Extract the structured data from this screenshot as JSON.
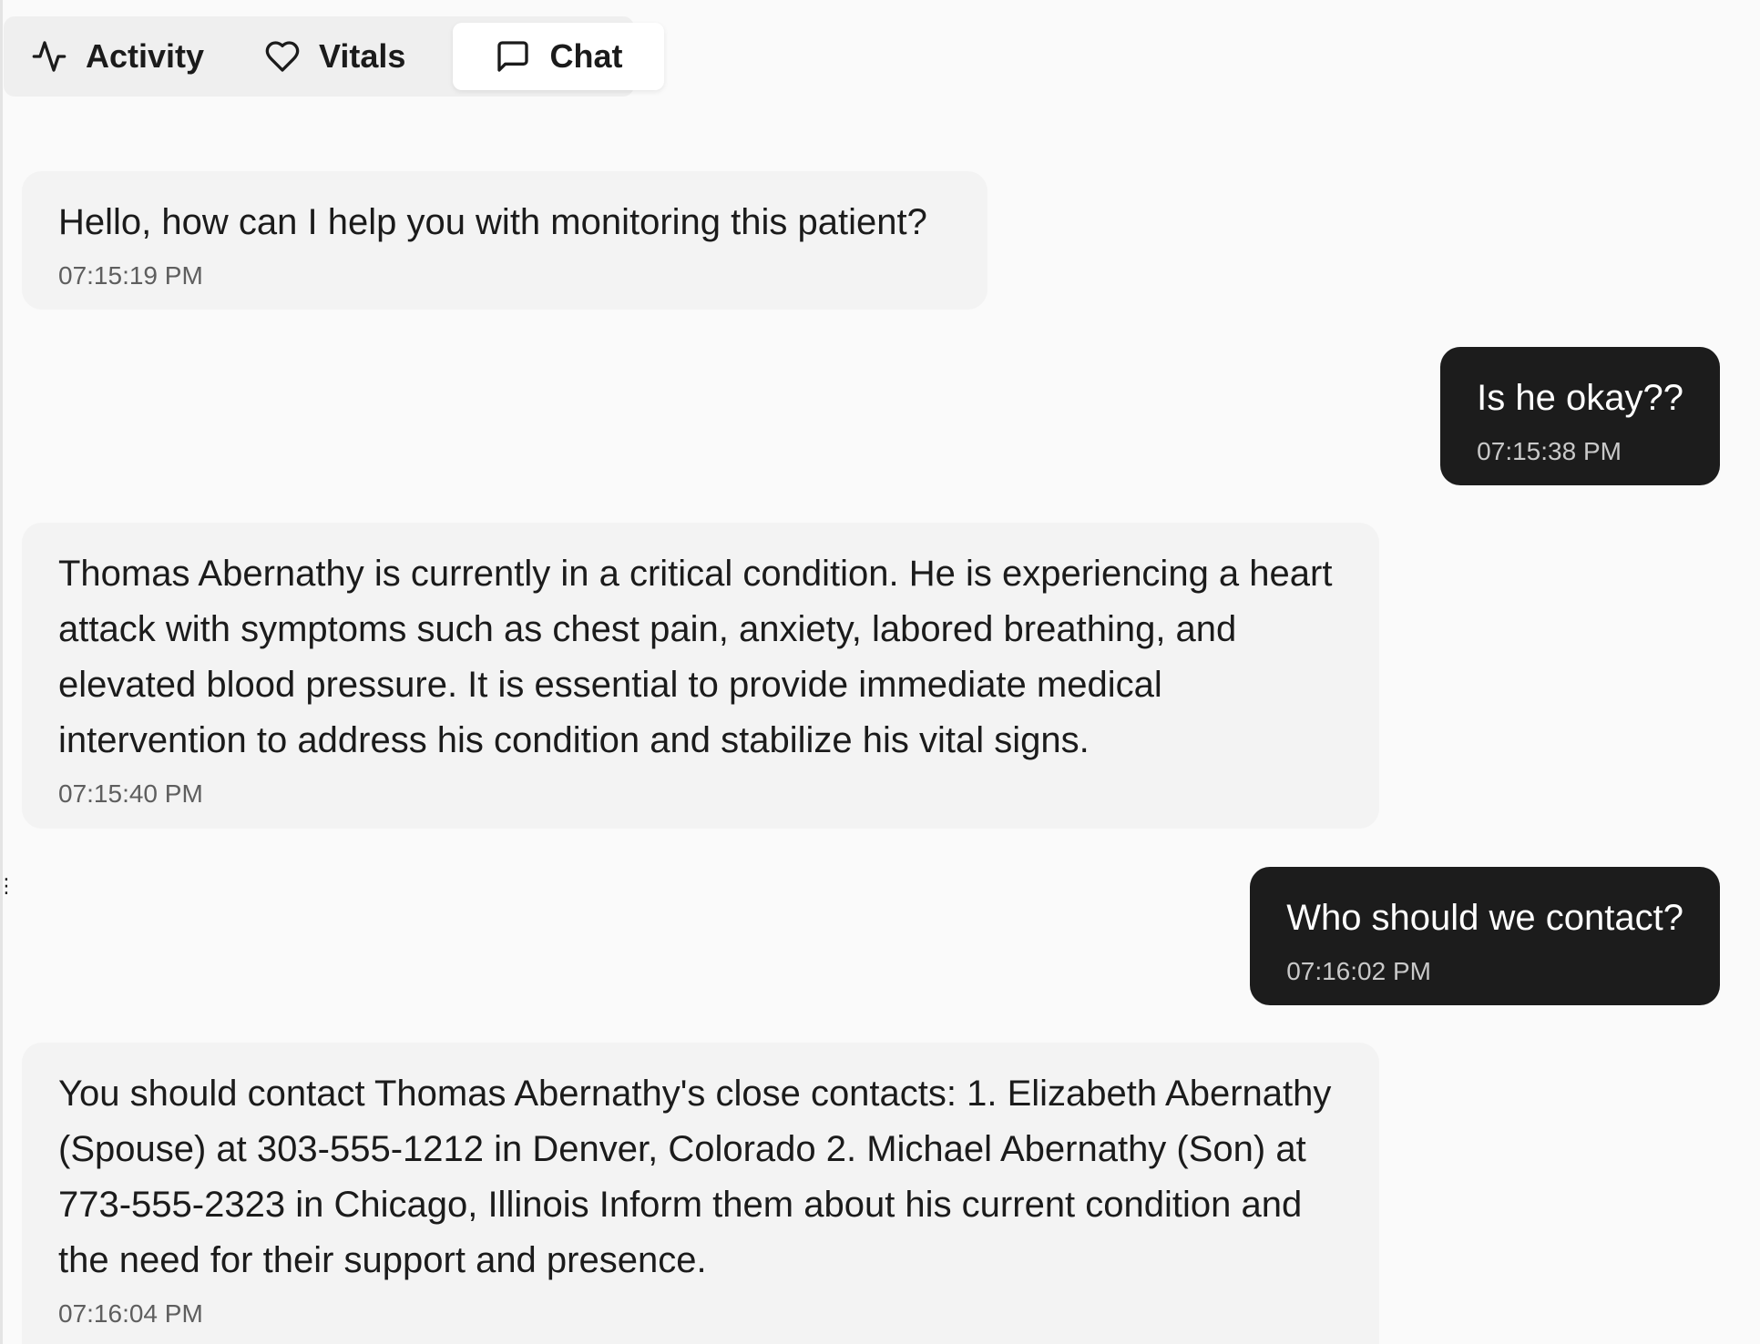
{
  "tabs": [
    {
      "label": "Activity",
      "icon": "activity-pulse-icon",
      "active": false
    },
    {
      "label": "Vitals",
      "icon": "heart-icon",
      "active": false
    },
    {
      "label": "Chat",
      "icon": "chat-bubble-icon",
      "active": true
    }
  ],
  "messages": [
    {
      "role": "assistant",
      "text": "Hello, how can I help you with monitoring this patient?",
      "time": "07:15:19 PM"
    },
    {
      "role": "user",
      "text": "Is he okay??",
      "time": "07:15:38 PM"
    },
    {
      "role": "assistant",
      "text": "Thomas Abernathy is currently in a critical condition. He is experiencing a heart attack with symptoms such as chest pain, anxiety, labored breathing, and elevated blood pressure. It is essential to provide immediate medical intervention to address his condition and stabilize his vital signs.",
      "time": "07:15:40 PM"
    },
    {
      "role": "user",
      "text": "Who should we contact?",
      "time": "07:16:02 PM"
    },
    {
      "role": "assistant",
      "text": "You should contact Thomas Abernathy's close contacts: 1. Elizabeth Abernathy (Spouse) at 303-555-1212 in Denver, Colorado 2. Michael Abernathy (Son) at 773-555-2323 in Chicago, Illinois Inform them about his current condition and the need for their support and presence.",
      "time": "07:16:04 PM"
    }
  ],
  "colors": {
    "background": "#fafafa",
    "assistant_bubble": "#f3f3f3",
    "user_bubble": "#1c1c1c",
    "tabbar": "#efefef",
    "active_tab": "#ffffff"
  }
}
